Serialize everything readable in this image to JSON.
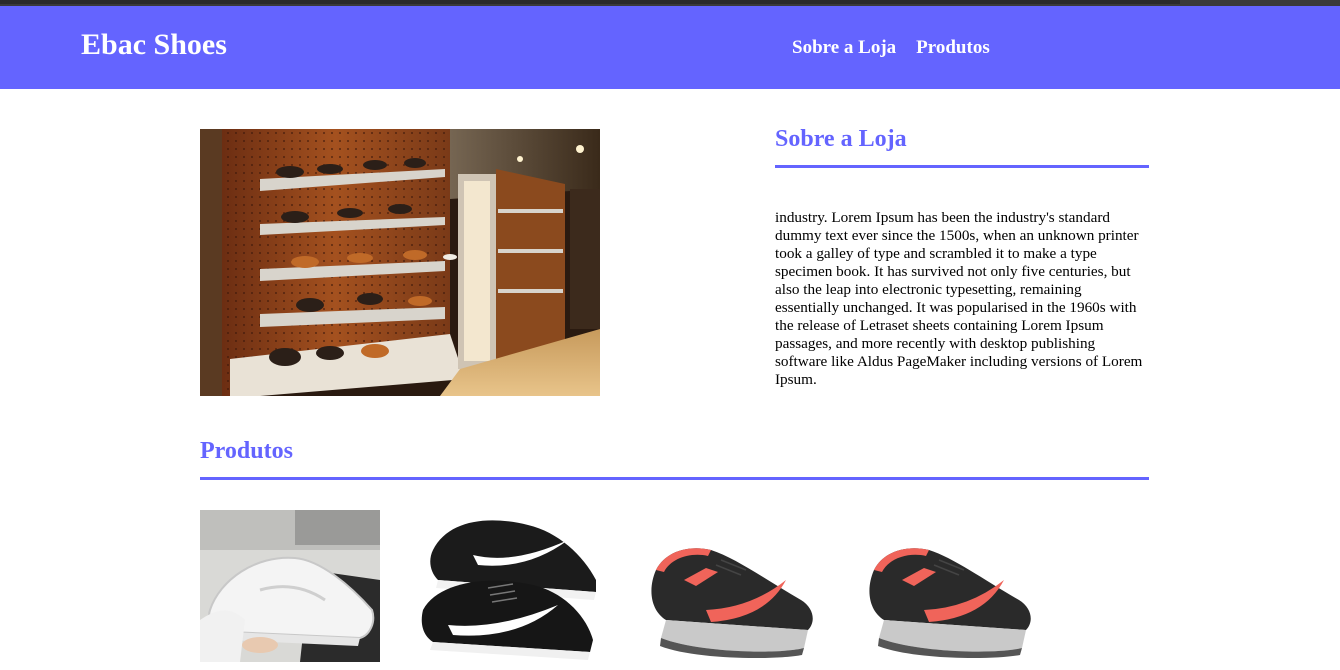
{
  "header": {
    "brand": "Ebac Shoes",
    "nav": [
      {
        "label": "Sobre a Loja"
      },
      {
        "label": "Produtos"
      }
    ]
  },
  "about": {
    "title": "Sobre a Loja",
    "text": "industry. Lorem Ipsum has been the industry's standard dummy text ever since the 1500s, when an unknown printer took a galley of type and scrambled it to make a type specimen book. It has survived not only five centuries, but also the leap into electronic typesetting, remaining essentially unchanged. It was popularised in the 1960s with the release of Letraset sheets containing Lorem Ipsum passages, and more recently with desktop publishing software like Aldus PageMaker including versions of Lorem Ipsum."
  },
  "products": {
    "title": "Produtos"
  },
  "colors": {
    "brand": "#6464ff",
    "text": "#000000",
    "background": "#ffffff"
  }
}
